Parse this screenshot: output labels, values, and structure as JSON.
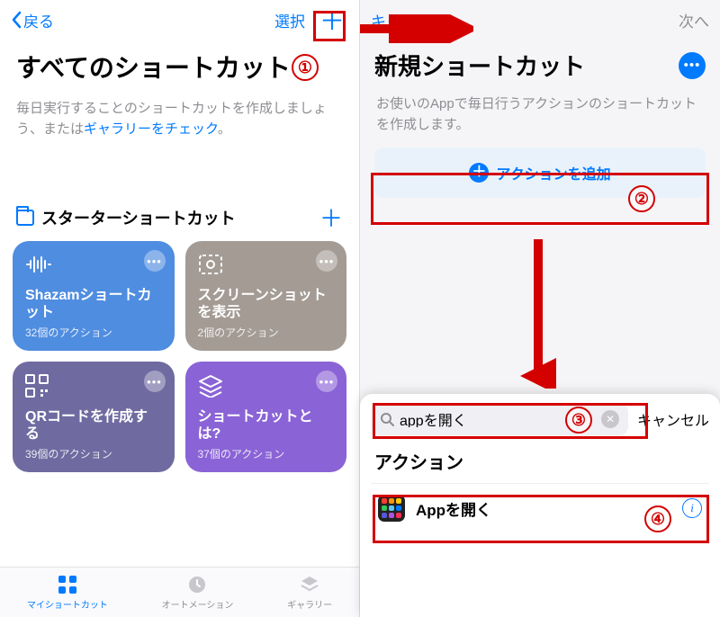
{
  "left": {
    "nav": {
      "back": "戻る",
      "select": "選択"
    },
    "title": "すべてのショートカット",
    "desc_pre": "毎日実行することのショートカットを作成しましょう、または",
    "desc_link": "ギャラリーをチェック",
    "desc_post": "。",
    "section": {
      "title": "スターターショートカット"
    },
    "tiles": {
      "a": {
        "title": "Shazamショートカット",
        "sub": "32個のアクション",
        "color": "#4f8de0"
      },
      "b": {
        "title": "スクリーンショットを表示",
        "sub": "2個のアクション",
        "color": "#a39b94"
      },
      "c": {
        "title": "QRコードを作成する",
        "sub": "39個のアクション",
        "color": "#6f6aa0"
      },
      "d": {
        "title": "ショートカットとは?",
        "sub": "37個のアクション",
        "color": "#8a63d6"
      }
    },
    "tabs": {
      "my": "マイショートカット",
      "auto": "オートメーション",
      "gallery": "ギャラリー"
    }
  },
  "right": {
    "nav": {
      "cancel": "キャンセル",
      "next": "次へ"
    },
    "title": "新規ショートカット",
    "desc": "お使いのAppで毎日行うアクションのショートカットを作成します。",
    "add_action": "アクションを追加",
    "search": {
      "value": "appを開く",
      "cancel": "キャンセル"
    },
    "section_header": "アクション",
    "result": "Appを開く"
  },
  "anno": {
    "n1": "①",
    "n2": "②",
    "n3": "③",
    "n4": "④"
  }
}
